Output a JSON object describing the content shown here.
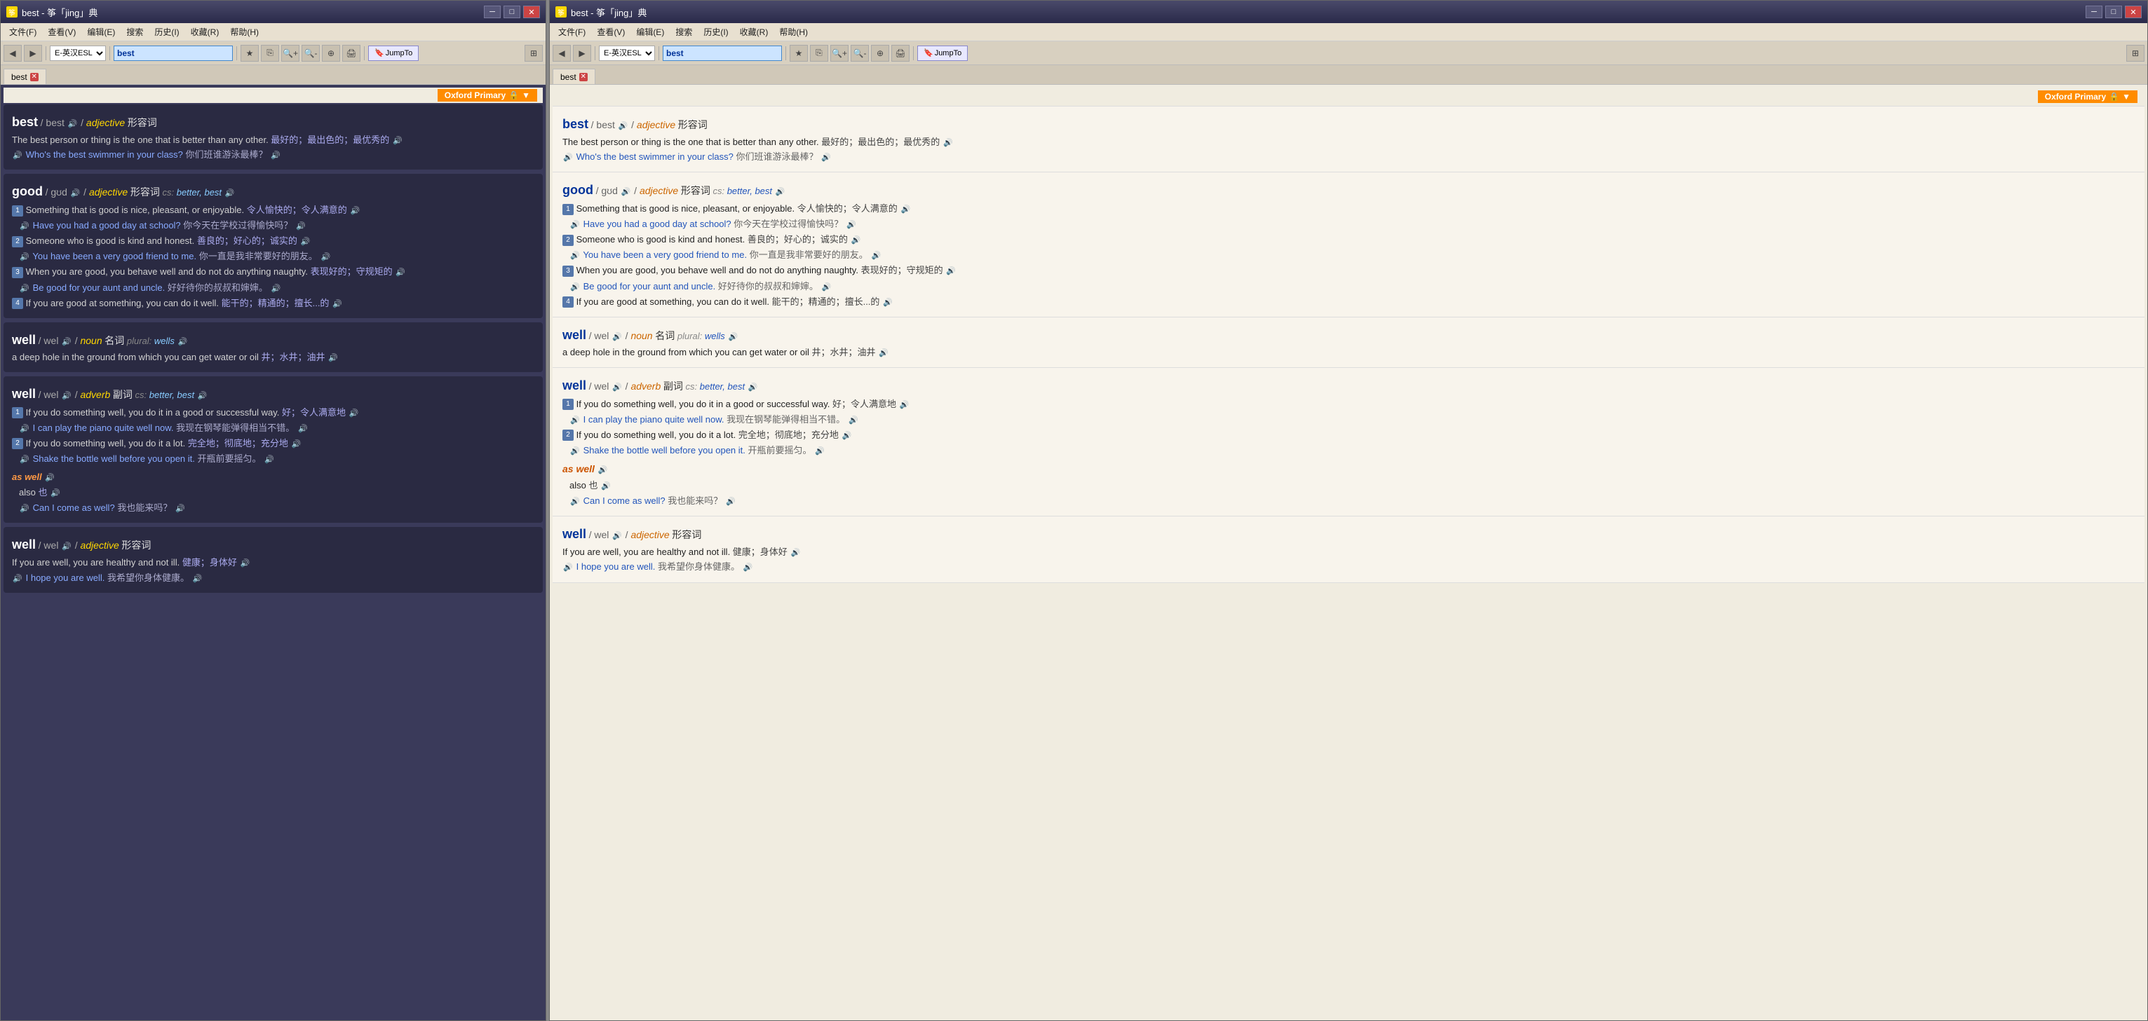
{
  "windows": [
    {
      "id": "left",
      "title": "best - 筝「jing」典",
      "menu": [
        "文件(F)",
        "查看(V)",
        "编辑(E)",
        "搜索",
        "历史(I)",
        "收藏(R)",
        "帮助(H)"
      ],
      "toolbar": {
        "dict_select": "E-英汉ESL",
        "search_input": "best",
        "jumpto_label": "JumpTo"
      },
      "tab": "best",
      "oxford_badge": "Oxford Primary",
      "entries": [
        {
          "word": "best",
          "pron": "/ best",
          "sound": true,
          "pos": "adjective",
          "cn_pos": "形容词",
          "def_en": "The best person or thing is the one that is better than any other.",
          "def_cn": "最好的；最出色的；最优秀的",
          "examples": [
            {
              "en": "Who's the best swimmer in your class?",
              "cn": "你们班谁游泳最棒？",
              "sound": true
            }
          ]
        },
        {
          "word": "good",
          "pron": "/ gʊd",
          "sound": true,
          "pos": "adjective",
          "cn_pos": "形容词",
          "cs_label": "cs:",
          "cs_vals": "better, best",
          "defs": [
            {
              "num": 1,
              "en": "Something that is good is nice, pleasant, or enjoyable.",
              "cn": "令人愉快的；令人满意的",
              "sound": true,
              "examples": [
                {
                  "en": "Have you had a good day at school?",
                  "cn": "你今天在学校过得愉快吗？",
                  "sound": true
                }
              ]
            },
            {
              "num": 2,
              "en": "Someone who is good is kind and honest.",
              "cn": "善良的；好心的；诚实的",
              "sound": true,
              "examples": [
                {
                  "en": "You have been a very good friend to me.",
                  "cn": "你一直是我非常要好的朋友。",
                  "sound": true
                }
              ]
            },
            {
              "num": 3,
              "en": "When you are good, you behave well and do not do anything naughty.",
              "cn": "表现好的；守规矩的",
              "sound": true,
              "examples": [
                {
                  "en": "Be good for your aunt and uncle.",
                  "cn": "好好待你的叔叔和婶婶。",
                  "sound": true
                }
              ]
            },
            {
              "num": 4,
              "en": "If you are good at something, you can do it well.",
              "cn": "能干的；精通的；擅长...的",
              "sound": true,
              "examples": []
            }
          ]
        },
        {
          "word": "well",
          "pron": "/ wel",
          "sound": true,
          "pos": "noun",
          "cn_pos": "名词",
          "plural_label": "plural:",
          "plural_val": "wells",
          "def_en": "a deep hole in the ground from which you can get water or oil",
          "def_cn": "井；水井；油井",
          "examples": []
        },
        {
          "word": "well",
          "pron": "/ wel",
          "sound": true,
          "pos": "adverb",
          "cn_pos": "副词",
          "cs_label": "cs:",
          "cs_vals": "better, best",
          "defs": [
            {
              "num": 1,
              "en": "If you do something well, you do it in a good or successful way.",
              "cn": "好；令人满意地",
              "sound": true,
              "examples": [
                {
                  "en": "I can play the piano quite well now.",
                  "cn": "我现在钢琴能弹得相当不错。",
                  "sound": true
                }
              ]
            },
            {
              "num": 2,
              "en": "If you do something well, you do it a lot.",
              "cn": "完全地；彻底地；充分地",
              "sound": true,
              "examples": [
                {
                  "en": "Shake the bottle well before you open it.",
                  "cn": "开瓶前要摇匀。",
                  "sound": true
                }
              ]
            }
          ],
          "as_well": {
            "phrase": "as well",
            "sound": true,
            "def_cn": "also 也",
            "examples": [
              {
                "en": "Can I come as well?",
                "cn": "我也能来吗？",
                "sound": true
              }
            ]
          }
        },
        {
          "word": "well",
          "pron": "/ wel",
          "sound": true,
          "pos": "adjective",
          "cn_pos": "形容词",
          "def_en": "If you are well, you are healthy and not ill.",
          "def_cn": "健康；身体好",
          "examples": [
            {
              "en": "I hope you are well.",
              "cn": "我希望你身体健康。",
              "sound": true
            }
          ]
        }
      ]
    },
    {
      "id": "right",
      "title": "best - 筝「jing」典",
      "menu": [
        "文件(F)",
        "查看(V)",
        "编辑(E)",
        "搜索",
        "历史(I)",
        "收藏(R)",
        "帮助(H)"
      ],
      "toolbar": {
        "dict_select": "E-英汉ESL",
        "search_input": "best",
        "jumpto_label": "JumpTo"
      },
      "tab": "best",
      "oxford_badge": "Oxford Primary"
    }
  ]
}
